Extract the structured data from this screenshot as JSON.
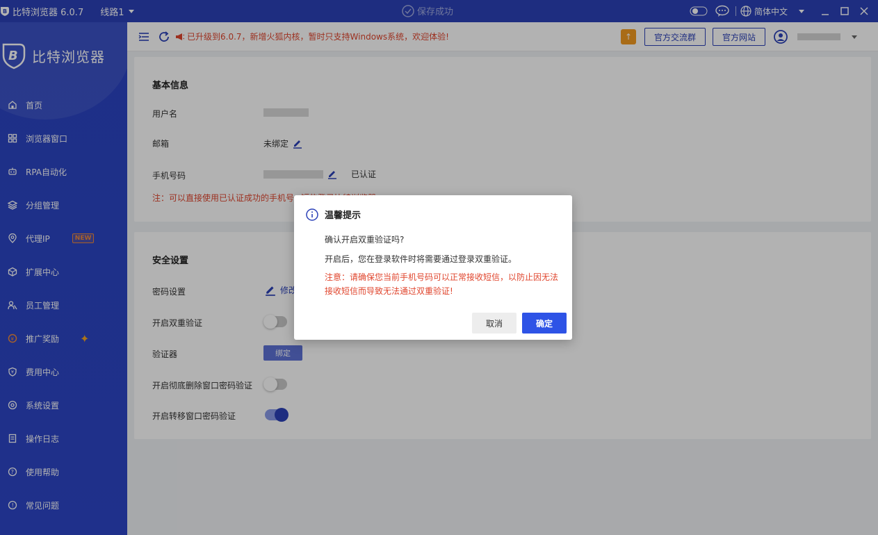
{
  "titlebar": {
    "app_name": "比特浏览器 6.0.7",
    "line_label": "线路1",
    "toast_text": "保存成功",
    "language": "简体中文"
  },
  "sidebar": {
    "brand": "比特浏览器",
    "items": [
      {
        "label": "首页",
        "icon": "home-icon"
      },
      {
        "label": "浏览器窗口",
        "icon": "grid-icon"
      },
      {
        "label": "RPA自动化",
        "icon": "robot-icon"
      },
      {
        "label": "分组管理",
        "icon": "layers-icon"
      },
      {
        "label": "代理IP",
        "icon": "location-icon",
        "badge": "NEW"
      },
      {
        "label": "扩展中心",
        "icon": "cube-icon"
      },
      {
        "label": "员工管理",
        "icon": "users-icon"
      },
      {
        "label": "推广奖励",
        "icon": "reward-icon"
      },
      {
        "label": "费用中心",
        "icon": "shield-icon"
      },
      {
        "label": "系统设置",
        "icon": "gear-icon"
      },
      {
        "label": "操作日志",
        "icon": "log-icon"
      },
      {
        "label": "使用帮助",
        "icon": "help-icon"
      },
      {
        "label": "常见问题",
        "icon": "info-icon"
      }
    ]
  },
  "topbar": {
    "notice": "已升级到6.0.7，新增火狐内核，暂时只支持Windows系统，欢迎体验!",
    "group_btn": "官方交流群",
    "site_btn": "官方网站"
  },
  "basic": {
    "title": "基本信息",
    "username_label": "用户名",
    "email_label": "邮箱",
    "email_value": "未绑定",
    "phone_label": "手机号码",
    "phone_status": "已认证",
    "note": "注：可以直接使用已认证成功的手机号+短信登录比特浏览器"
  },
  "security": {
    "title": "安全设置",
    "password_label": "密码设置",
    "password_action": "修改",
    "twofa_label": "开启双重验证",
    "twofa_on": false,
    "authenticator_label": "验证器",
    "bind_label": "绑定",
    "delete_verify_label": "开启彻底删除窗口密码验证",
    "delete_verify_on": false,
    "transfer_verify_label": "开启转移窗口密码验证",
    "transfer_verify_on": true
  },
  "dialog": {
    "title": "温馨提示",
    "question": "确认开启双重验证吗?",
    "description": "开启后，您在登录软件时将需要通过登录双重验证。",
    "warning": "注意：请确保您当前手机号码可以正常接收短信，以防止因无法接收短信而导致无法通过双重验证!",
    "cancel": "取消",
    "confirm": "确定"
  },
  "colors": {
    "primary": "#2b41b8",
    "accent": "#2e53e6",
    "danger": "#e0462e",
    "warning_orange": "#f29b21"
  }
}
